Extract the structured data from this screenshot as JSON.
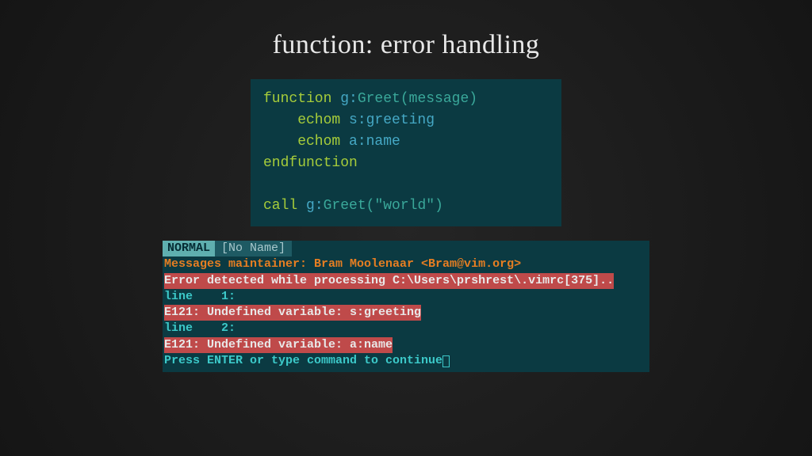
{
  "title": "function: error handling",
  "code": {
    "l1_kw": "function",
    "l1_scope": " g:",
    "l1_func": "Greet",
    "l1_open": "(",
    "l1_arg": "message",
    "l1_close": ")",
    "l2_kw": "    echom",
    "l2_scope": " s:",
    "l2_var": "greeting",
    "l3_kw": "    echom",
    "l3_scope": " a:",
    "l3_var": "name",
    "l4_kw": "endfunction",
    "l5_blank": " ",
    "l6_kw": "call",
    "l6_scope": " g:",
    "l6_func": "Greet",
    "l6_open": "(",
    "l6_str": "\"world\"",
    "l6_close": ")"
  },
  "terminal": {
    "mode": " NORMAL ",
    "file": "[No Name]",
    "maintainer": "Messages maintainer: Bram Moolenaar <Bram@vim.org>",
    "err_header": "Error detected while processing C:\\Users\\prshrest\\.vimrc[375]..",
    "line1": "line    1:",
    "e1": "E121: Undefined variable: s:greeting",
    "line2": "line    2:",
    "e2": "E121: Undefined variable: a:name",
    "press": "Press ENTER or type command to continue"
  }
}
